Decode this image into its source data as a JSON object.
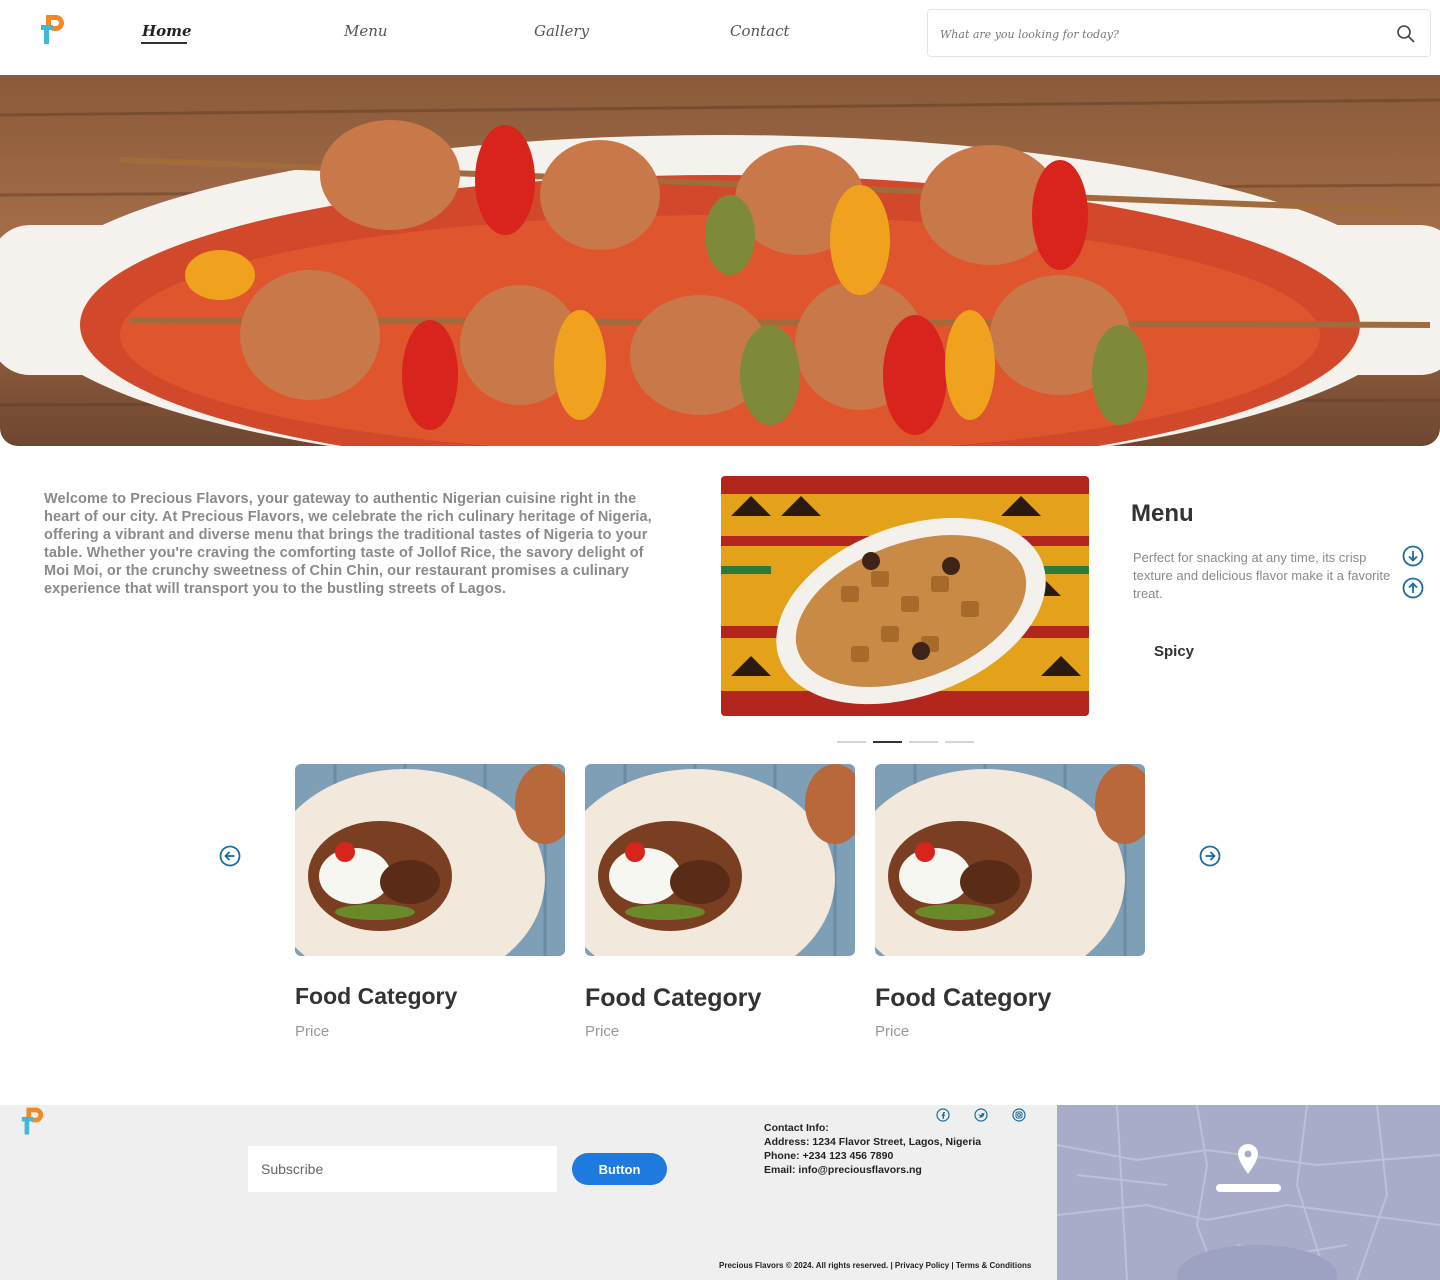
{
  "brand": {
    "name": "Precious Flavors",
    "primary_color": "#f08a24",
    "secondary_color": "#3fb9d6",
    "accent_blue": "#1f7ae0",
    "icon_blue": "#1a6e9a"
  },
  "nav": {
    "items": [
      {
        "label": "Home",
        "active": true
      },
      {
        "label": "Menu",
        "active": false
      },
      {
        "label": "Gallery",
        "active": false
      },
      {
        "label": "Contact",
        "active": false
      }
    ]
  },
  "search": {
    "placeholder": "What are you looking for today?",
    "value": "",
    "icon": "search-icon"
  },
  "hero": {
    "image": "jollof-rice-chicken-skewers-photo"
  },
  "intro": {
    "text": "Welcome to Precious Flavors, your gateway to authentic Nigerian cuisine right in the heart of our city. At Precious Flavors, we celebrate the rich culinary heritage of Nigeria, offering a vibrant and diverse menu that brings the traditional tastes of Nigeria to your table. Whether you're craving the comforting taste of Jollof Rice, the savory delight of Moi Moi, or the crunchy sweetness of Chin Chin, our restaurant promises a culinary experience that will transport you to the bustling streets of Lagos."
  },
  "menu_panel": {
    "title": "Menu",
    "description": "Perfect for snacking at any time, its crisp texture and delicious flavor make it a favorite treat.",
    "tag": "Spicy",
    "image": "chin-chin-bowl-photo",
    "down_icon": "arrow-down-circle-icon",
    "up_icon": "arrow-up-circle-icon",
    "slides_count": 4,
    "active_slide": 2
  },
  "carousel": {
    "prev_icon": "arrow-left-circle-icon",
    "next_icon": "arrow-right-circle-icon",
    "cards": [
      {
        "title": "Food Category",
        "price": "Price",
        "image": "rice-stew-plate-photo"
      },
      {
        "title": "Food Category",
        "price": "Price",
        "image": "rice-stew-plate-photo"
      },
      {
        "title": "Food Category",
        "price": "Price",
        "image": "rice-stew-plate-photo"
      }
    ]
  },
  "footer": {
    "subscribe_placeholder": "Subscribe",
    "button_label": "Button",
    "contact": {
      "heading": "Contact Info:",
      "address": "Address: 1234 Flavor Street, Lagos, Nigeria",
      "phone": "Phone: +234 123 456 7890",
      "email": "Email: info@preciousflavors.ng"
    },
    "social": [
      "facebook-icon",
      "twitter-icon",
      "instagram-icon"
    ],
    "copyright": "Precious Flavors © 2024. All rights reserved.",
    "privacy": "Privacy Policy",
    "terms": "Terms & Conditions",
    "separator": " | ",
    "map_icon": "map-pin-icon"
  }
}
